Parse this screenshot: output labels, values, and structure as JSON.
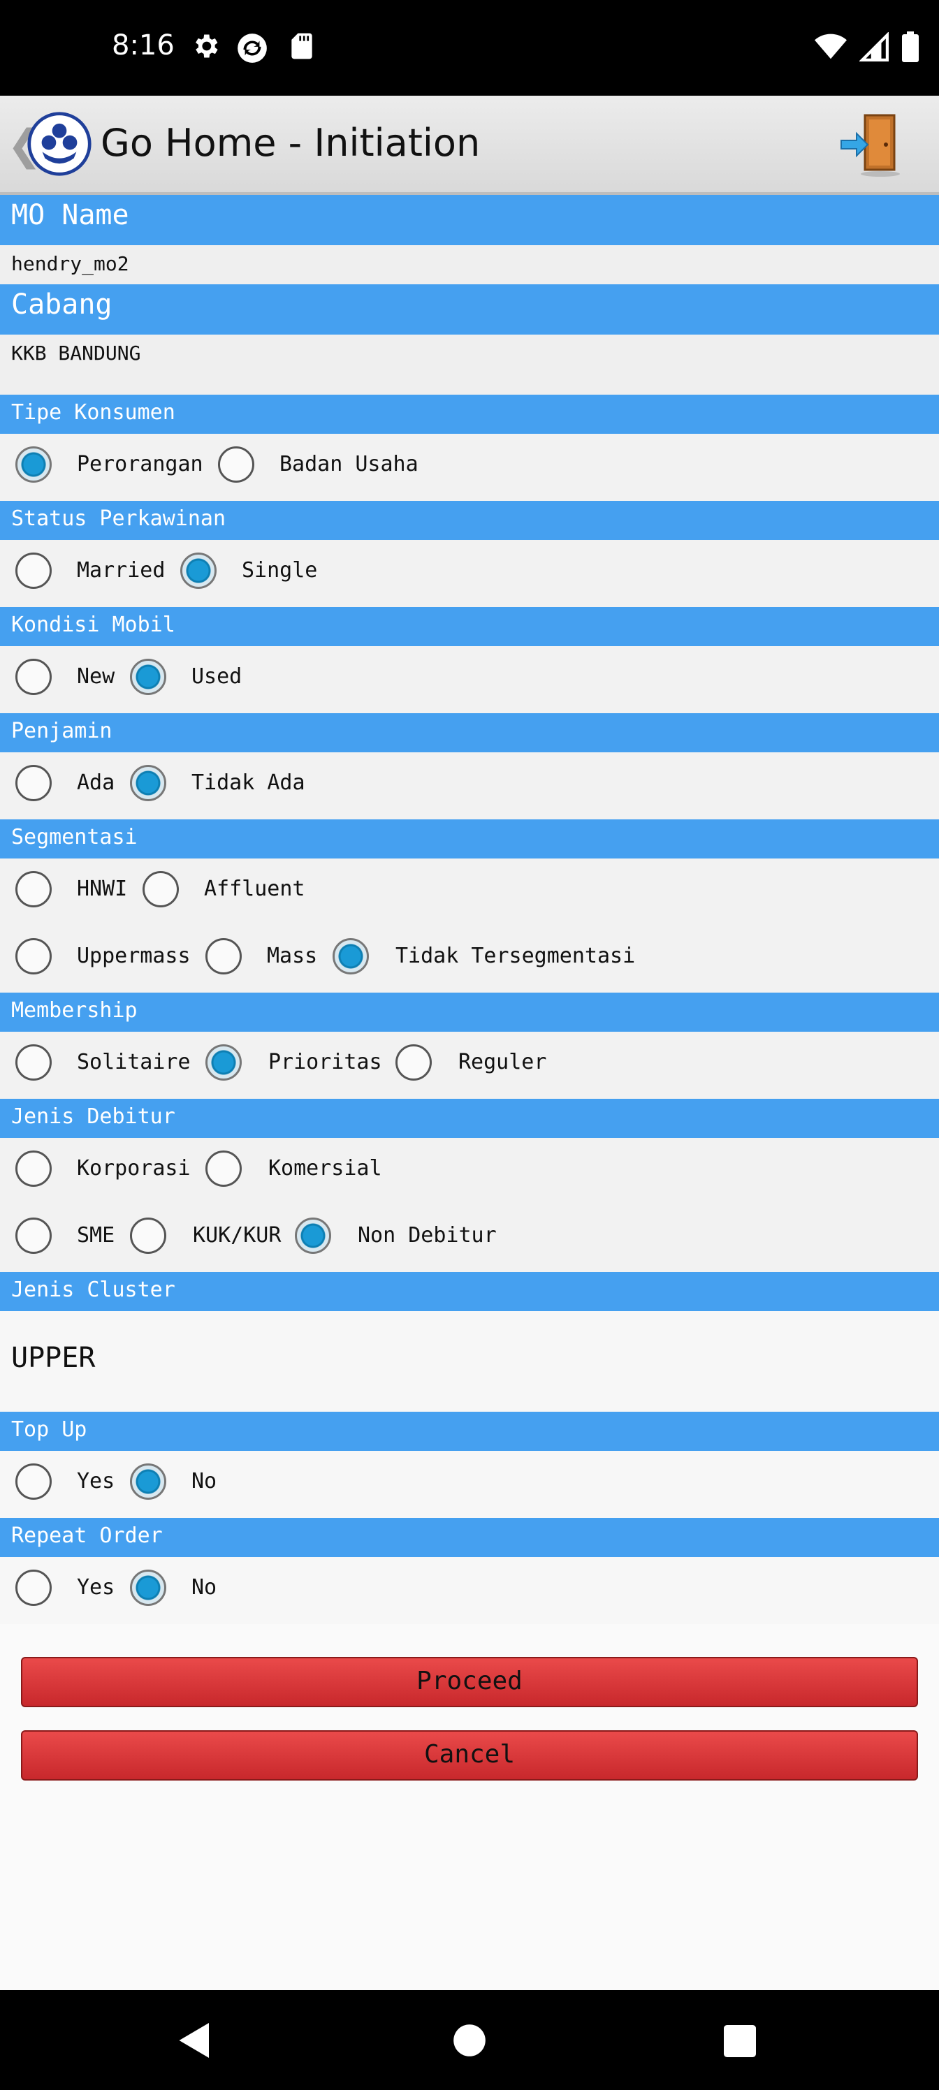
{
  "status": {
    "time": "8:16"
  },
  "app": {
    "title": "Go Home - Initiation",
    "back": "❮"
  },
  "mo_name": {
    "label": "MO Name",
    "value": "hendry_mo2"
  },
  "cabang": {
    "label": "Cabang",
    "value": "KKB BANDUNG"
  },
  "tipe_konsumen": {
    "label": "Tipe Konsumen",
    "options": [
      "Perorangan",
      "Badan Usaha"
    ],
    "selected": "Perorangan"
  },
  "status_perkawinan": {
    "label": "Status Perkawinan",
    "options": [
      "Married",
      "Single"
    ],
    "selected": "Single"
  },
  "kondisi_mobil": {
    "label": "Kondisi Mobil",
    "options": [
      "New",
      "Used"
    ],
    "selected": "Used"
  },
  "penjamin": {
    "label": "Penjamin",
    "options": [
      "Ada",
      "Tidak Ada"
    ],
    "selected": "Tidak Ada"
  },
  "segmentasi": {
    "label": "Segmentasi",
    "options": [
      "HNWI",
      "Affluent",
      "Uppermass",
      "Mass",
      "Tidak Tersegmentasi"
    ],
    "selected": "Tidak Tersegmentasi"
  },
  "membership": {
    "label": "Membership",
    "options": [
      "Solitaire",
      "Prioritas",
      "Reguler"
    ],
    "selected": "Prioritas"
  },
  "jenis_debitur": {
    "label": "Jenis Debitur",
    "options": [
      "Korporasi",
      "Komersial",
      "SME",
      "KUK/KUR",
      "Non Debitur"
    ],
    "selected": "Non Debitur"
  },
  "jenis_cluster": {
    "label": "Jenis Cluster",
    "value": "UPPER"
  },
  "top_up": {
    "label": "Top Up",
    "options": [
      "Yes",
      "No"
    ],
    "selected": "No"
  },
  "repeat_order": {
    "label": "Repeat Order",
    "options": [
      "Yes",
      "No"
    ],
    "selected": "No"
  },
  "buttons": {
    "proceed": "Proceed",
    "cancel": "Cancel"
  },
  "colors": {
    "header_blue": "#45a0f0",
    "button_red": "#d83434",
    "radio_checked": "#1a9ad6"
  }
}
